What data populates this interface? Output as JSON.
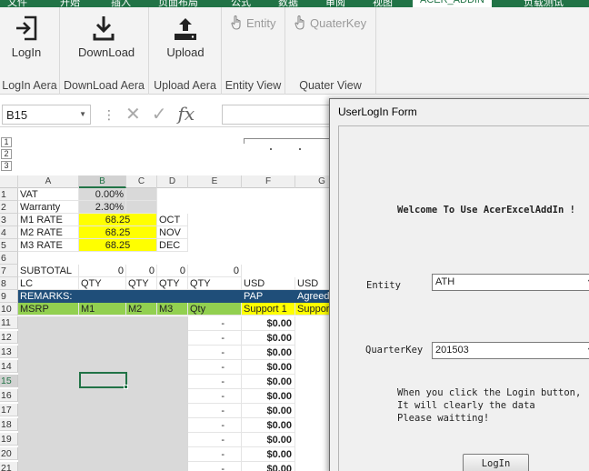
{
  "ribbon": {
    "tabs": [
      "文件",
      "开始",
      "插入",
      "页面布局",
      "公式",
      "数据",
      "审阅",
      "视图",
      "ACER_ADDIN",
      "负载测试"
    ],
    "groups": {
      "login": {
        "label": "LogIn Aera",
        "button": "LogIn",
        "icon": "login-icon"
      },
      "download": {
        "label": "DownLoad Aera",
        "button": "DownLoad",
        "icon": "download-icon"
      },
      "upload": {
        "label": "Upload Aera",
        "button": "Upload",
        "icon": "upload-icon"
      },
      "entity": {
        "label": "Entity View",
        "button": "Entity",
        "icon": "pointer-hand-icon"
      },
      "quater": {
        "label": "Quater View",
        "button": "QuaterKey",
        "icon": "pointer-hand-icon"
      }
    }
  },
  "formula_bar": {
    "name_box": "B15",
    "formula": ""
  },
  "outline_levels": [
    "1",
    "2",
    "3"
  ],
  "columns": [
    "A",
    "B",
    "C",
    "D",
    "E",
    "F",
    "G"
  ],
  "rows": [
    "1",
    "2",
    "3",
    "4",
    "5",
    "6",
    "7",
    "8",
    "9",
    "10",
    "11",
    "12",
    "13",
    "14",
    "15",
    "16",
    "17",
    "18",
    "19",
    "20",
    "21"
  ],
  "cells": {
    "r1": {
      "a": "VAT",
      "b": "0.00%"
    },
    "r2": {
      "a": "Warranty",
      "b": "2.30%"
    },
    "r3": {
      "a": "M1 RATE",
      "b": "68.25",
      "d": "OCT"
    },
    "r4": {
      "a": "M2 RATE",
      "b": "68.25",
      "d": "NOV"
    },
    "r5": {
      "a": "M3 RATE",
      "b": "68.25",
      "d": "DEC"
    },
    "r7": {
      "a": "SUBTOTAL",
      "b": "0",
      "c": "0",
      "d": "0",
      "e": "0"
    },
    "r8": {
      "a": "LC",
      "b": "QTY",
      "c": "QTY",
      "d": "QTY",
      "e": "QTY",
      "f": "USD",
      "g": "USD"
    },
    "r9": {
      "a": "REMARKS:",
      "f": "PAP",
      "g": "Agreed"
    },
    "r10": {
      "a": "MSRP",
      "b": "M1",
      "c": "M2",
      "d": "M3",
      "e": "Qty",
      "f": "Support 1",
      "g": "Support"
    },
    "dash": "-",
    "usd_zero": "$0.00"
  },
  "dialog": {
    "title": "UserLogIn Form",
    "welcome": "Welcome To Use AcerExcelAddIn !",
    "entity_label": "Entity",
    "entity_value": "ATH",
    "quarter_label": "QuarterKey",
    "quarter_value": "201503",
    "note": "When you click the Login button,\nIt will clearly the data\nPlease waitting!",
    "login_button": "LogIn"
  },
  "colors": {
    "excel_green": "#217346",
    "yellow": "#ffff00",
    "remarks_blue": "#1f4e79",
    "msrp_green": "#92d050",
    "gray_fill": "#d9d9d9"
  }
}
